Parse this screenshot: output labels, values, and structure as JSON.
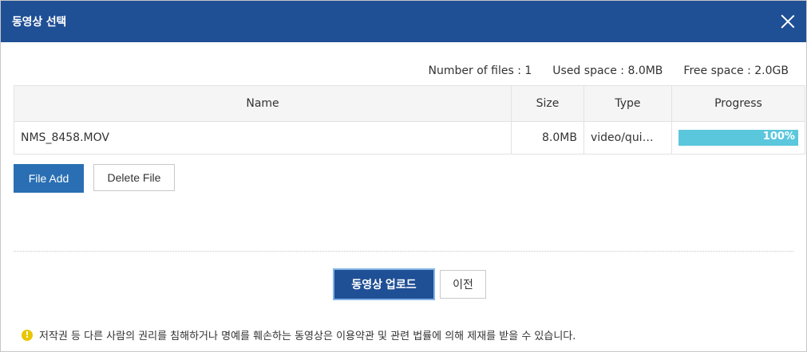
{
  "dialog": {
    "title": "동영상 선택"
  },
  "stats": {
    "files": "Number of files : 1",
    "used": "Used space : 8.0MB",
    "free": "Free space : 2.0GB"
  },
  "table": {
    "headers": [
      "Name",
      "Size",
      "Type",
      "Progress"
    ],
    "rows": [
      {
        "name": "NMS_8458.MOV",
        "size": "8.0MB",
        "type": "video/qui…",
        "progress": 100,
        "progress_label": "100%"
      }
    ]
  },
  "buttons": {
    "file_add": "File Add",
    "delete_file": "Delete File",
    "upload": "동영상 업로드",
    "previous": "이전"
  },
  "notice": {
    "text": "저작권 등 다른 사람의 권리를 침해하거나 명예를 훼손하는 동영상은 이용약관 및 관련 법률에 의해 제재를 받을 수 있습니다."
  },
  "colors": {
    "titlebar": "#1f4f95",
    "primary_button": "#2a6fb3",
    "progress_fill": "#5bc7dd",
    "warning_icon": "#e8c600"
  },
  "icons": {
    "close": "close-icon",
    "warning": "warning-icon"
  }
}
